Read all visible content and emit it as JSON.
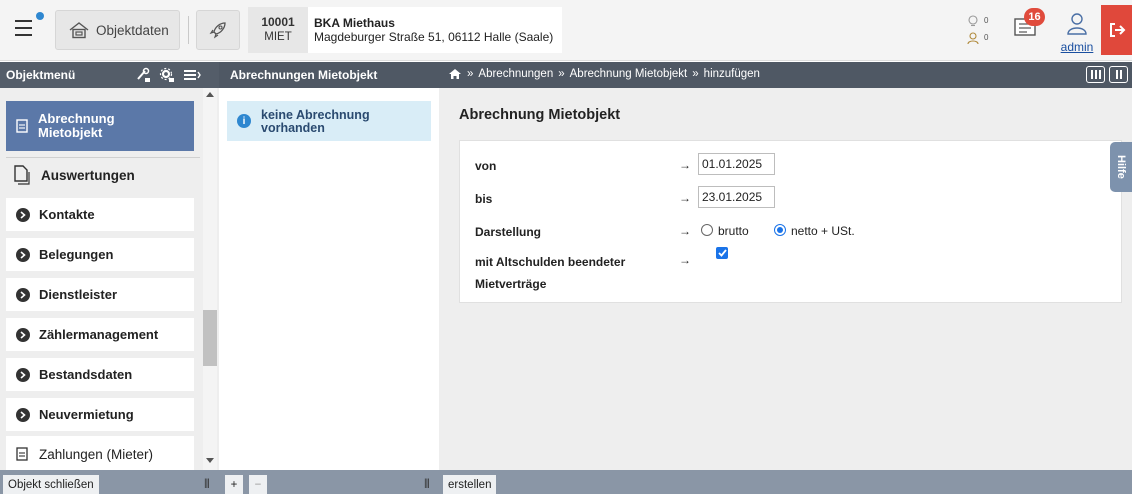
{
  "header": {
    "objektdaten_label": "Objektdaten",
    "object_number": "10001",
    "object_type": "MIET",
    "object_name": "BKA Miethaus",
    "object_address": "Magdeburger Straße 51, 06112 Halle (Saale)",
    "counter_a": "0",
    "counter_b": "0",
    "messages_count": "16",
    "user_name": "admin"
  },
  "navbar": {
    "menu_title": "Objektmenü",
    "list_title": "Abrechnungen Mietobjekt",
    "breadcrumb": [
      "Abrechnungen",
      "Abrechnung Mietobjekt",
      "hinzufügen"
    ],
    "breadcrumb_sep": "»"
  },
  "sidebar": {
    "active_item": {
      "line1": "Abrechnung",
      "line2": "Mietobjekt",
      "icon": "document-icon"
    },
    "items": [
      {
        "label": "Auswertungen",
        "icon": "copy-icon",
        "style": "flat"
      },
      {
        "label": "Kontakte",
        "icon": "chevron-circle-icon",
        "style": "card"
      },
      {
        "label": "Belegungen",
        "icon": "chevron-circle-icon",
        "style": "card"
      },
      {
        "label": "Dienstleister",
        "icon": "chevron-circle-icon",
        "style": "card"
      },
      {
        "label": "Zählermanagement",
        "icon": "chevron-circle-icon",
        "style": "card"
      },
      {
        "label": "Bestandsdaten",
        "icon": "chevron-circle-icon",
        "style": "card"
      },
      {
        "label": "Neuvermietung",
        "icon": "chevron-circle-icon",
        "style": "card"
      },
      {
        "label": "Zahlungen (Mieter)",
        "icon": "document-icon",
        "style": "flat"
      }
    ]
  },
  "list": {
    "empty_line1": "keine Abrechnung",
    "empty_line2": "vorhanden"
  },
  "main": {
    "title": "Abrechnung Mietobjekt",
    "arrow": "→",
    "von_label": "von",
    "von_value": "01.01.2025",
    "bis_label": "bis",
    "bis_value": "23.01.2025",
    "darstellung_label": "Darstellung",
    "option_brutto": "brutto",
    "option_netto": "netto + USt.",
    "selected_option": "netto + USt.",
    "altschulden_line1": "mit Altschulden beendeter",
    "altschulden_line2": "Mietverträge",
    "altschulden_checked": true,
    "help_tab": "Hilfe"
  },
  "bottombar": {
    "close_label": "Objekt schließen",
    "add_label": "+",
    "remove_label": "−",
    "create_label": "erstellen"
  },
  "colors": {
    "accent_blue": "#2e87d0",
    "sidebar_active": "#5b78a8",
    "navbar_bg": "#4f5864",
    "badge_red": "#e04b3c",
    "logout_red": "#e0483b",
    "info_bg": "#d9edf7",
    "bottombar_bg": "#8a96a6"
  }
}
